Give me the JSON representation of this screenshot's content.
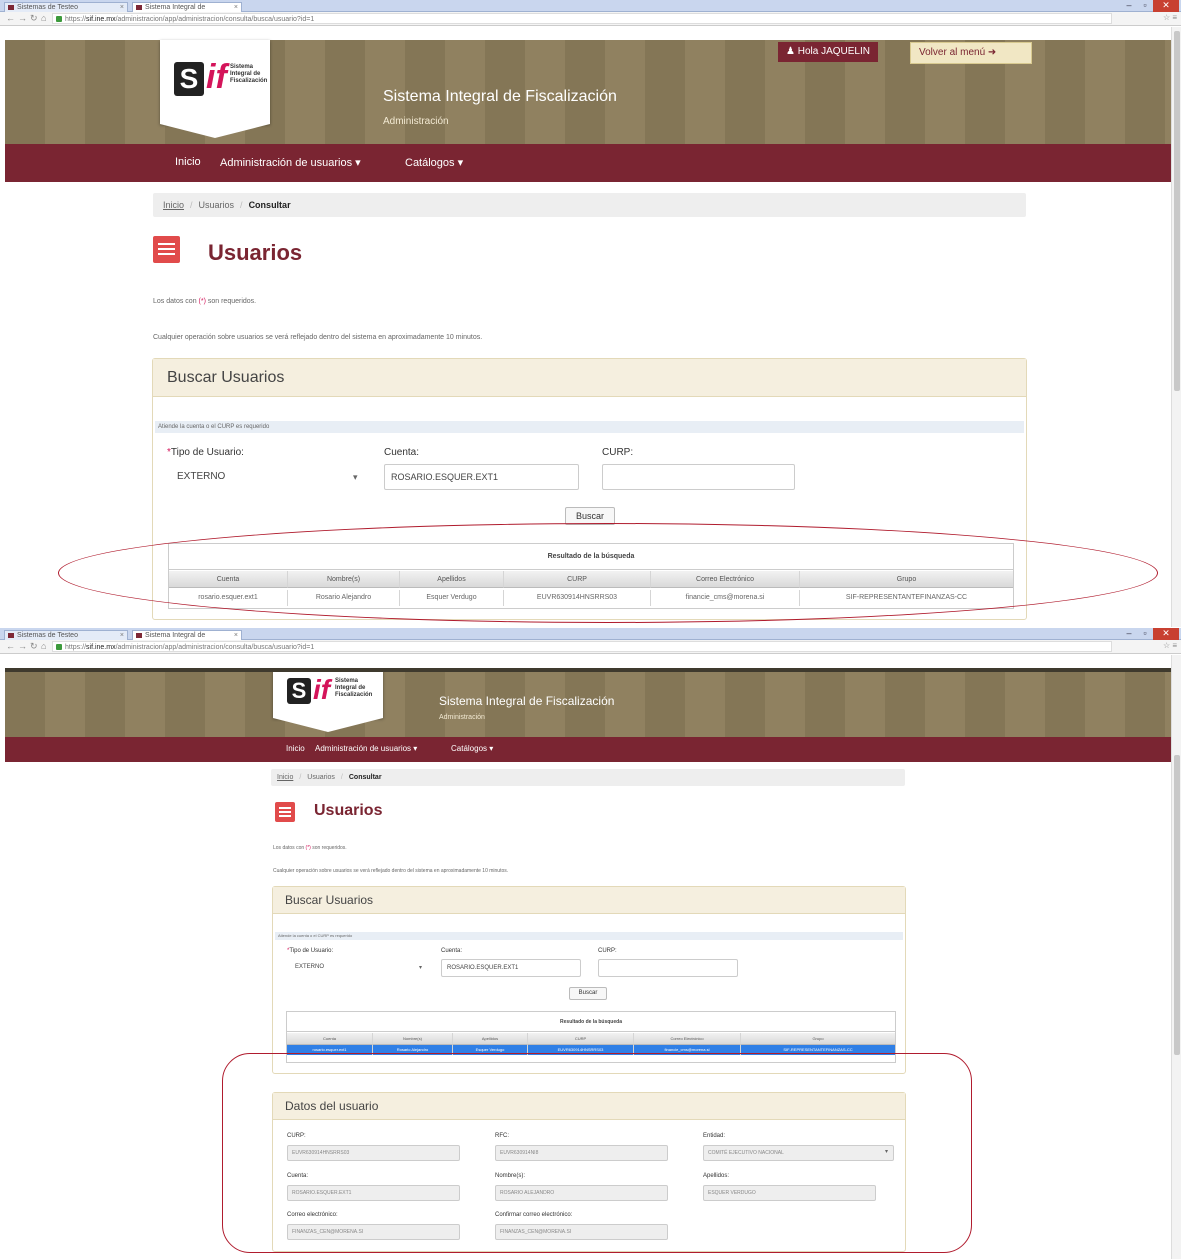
{
  "browser": {
    "tabs": [
      "Sistemas de Testeo",
      "Sistema Integral de"
    ],
    "url_host": "sif.ine.mx",
    "url_path": "/administracion/app/administracion/consulta/busca/usuario?id=1"
  },
  "header": {
    "logo_s": "S",
    "logo_if": "if",
    "logo_text": "Sistema Integral de Fiscalización",
    "title": "Sistema Integral de Fiscalización",
    "subtitle": "Administración",
    "user_button": "Hola JAQUELIN",
    "menu_button": "Volver al menú"
  },
  "nav": {
    "items": [
      "Inicio",
      "Administración de usuarios",
      "Catálogos"
    ]
  },
  "breadcrumb": [
    "Inicio",
    "Usuarios",
    "Consultar"
  ],
  "page": {
    "title": "Usuarios",
    "required_note_pre": "Los datos con ",
    "required_note_mark": "(*)",
    "required_note_post": " son requeridos.",
    "operation_note": "Cualquier operación sobre usuarios se verá reflejado dentro del sistema en aproximadamente 10 minutos."
  },
  "search": {
    "panel_title": "Buscar Usuarios",
    "info": "Atiende la cuenta o el CURP es requerido",
    "tipo_label": "Tipo de Usuario:",
    "tipo_value": "EXTERNO",
    "cuenta_label": "Cuenta:",
    "cuenta_value": "ROSARIO.ESQUER.EXT1",
    "curp_label": "CURP:",
    "curp_value": "",
    "buscar_button": "Buscar"
  },
  "results": {
    "caption": "Resultado de la búsqueda",
    "columns": [
      "Cuenta",
      "Nombre(s)",
      "Apellidos",
      "CURP",
      "Correo Electrónico",
      "Grupo"
    ],
    "rows": [
      [
        "rosario.esquer.ext1",
        "Rosario Alejandro",
        "Esquer Verdugo",
        "EUVR630914HNSRRS03",
        "financie_cms@morena.si",
        "SIF-REPRESENTANTEFINANZAS-CC"
      ]
    ]
  },
  "user_details": {
    "panel_title": "Datos del usuario",
    "fields": [
      {
        "label": "CURP:",
        "value": "EUVR630914HNSRRS03"
      },
      {
        "label": "RFC:",
        "value": "EUVR630914NI8"
      },
      {
        "label": "Entidad:",
        "value": "COMITÉ EJECUTIVO NACIONAL"
      },
      {
        "label": "Cuenta:",
        "value": "ROSARIO.ESQUER.EXT1"
      },
      {
        "label": "Nombre(s):",
        "value": "ROSARIO ALEJANDRO"
      },
      {
        "label": "Apellidos:",
        "value": "ESQUER VERDUGO"
      },
      {
        "label": "Correo electrónico:",
        "value": "FINANZAS_CEN@MORENA.SI"
      },
      {
        "label": "Confirmar correo electrónico:",
        "value": "FINANZAS_CEN@MORENA.SI"
      }
    ]
  },
  "colors": {
    "header_bg": "#8c7d5b",
    "nav_bg": "#7a2532",
    "accent": "#d4145a",
    "annotation": "#b01c2e",
    "selected_row": "#2f7fe6"
  }
}
